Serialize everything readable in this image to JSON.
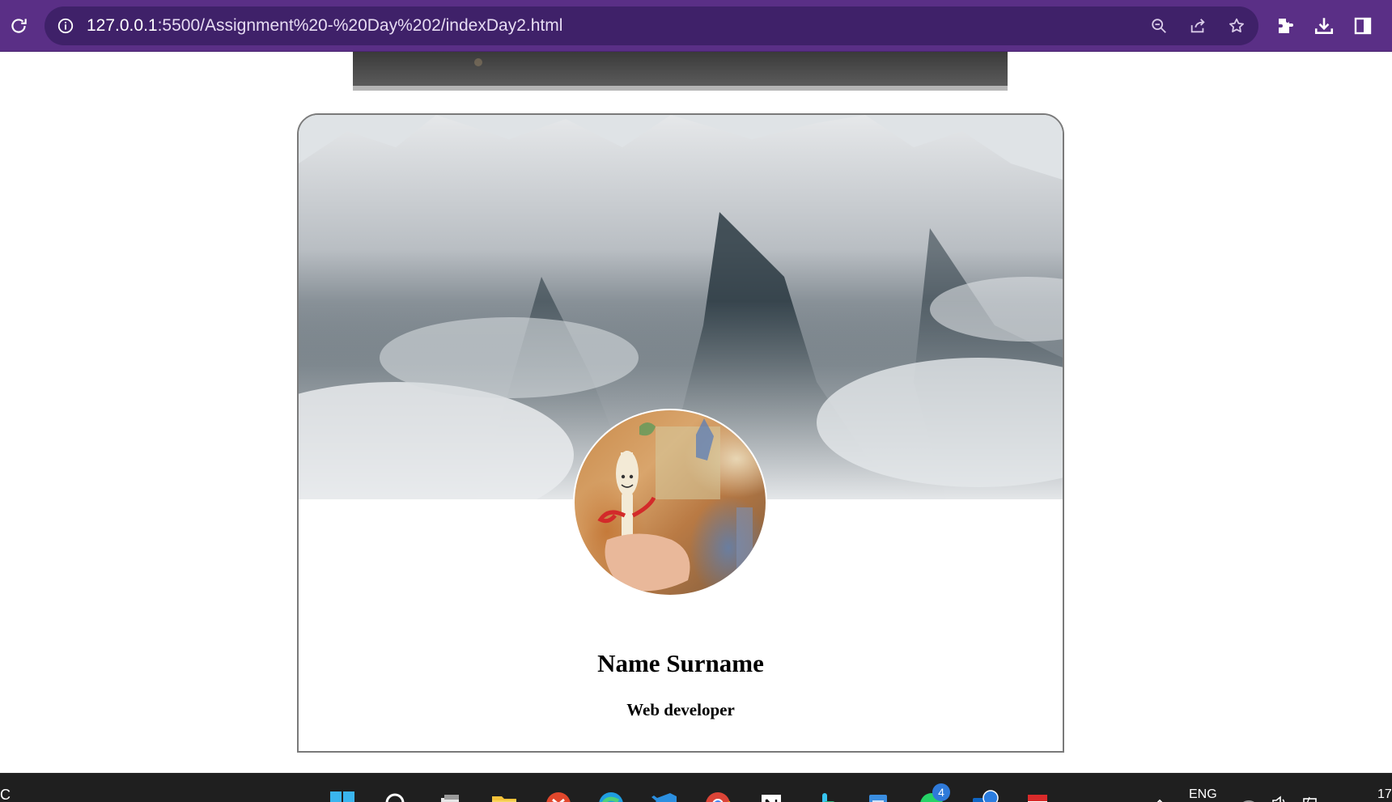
{
  "browser": {
    "url_host": "127.0.0.1",
    "url_path": ":5500/Assignment%20-%20Day%202/indexDay2.html",
    "accent_color": "#5a2f86"
  },
  "toolbar_icons": [
    "reload-icon",
    "site-info-icon",
    "zoom-icon",
    "share-icon",
    "bookmark-star-icon",
    "extensions-icon",
    "download-icon",
    "side-panel-icon"
  ],
  "profile": {
    "name": "Name Surname",
    "role": "Web developer"
  },
  "taskbar": {
    "edge_text": "C",
    "lang": "ENG",
    "clock": "17",
    "whatsapp_badge": "4",
    "apps": [
      "windows-start-icon",
      "search-icon",
      "task-view-icon",
      "file-explorer-icon",
      "xampp-icon",
      "edge-icon",
      "vscode-icon",
      "chrome-icon",
      "notion-icon",
      "slack-icon",
      "notepad-icon",
      "whatsapp-icon",
      "outlook-icon",
      "acrobat-icon"
    ]
  }
}
